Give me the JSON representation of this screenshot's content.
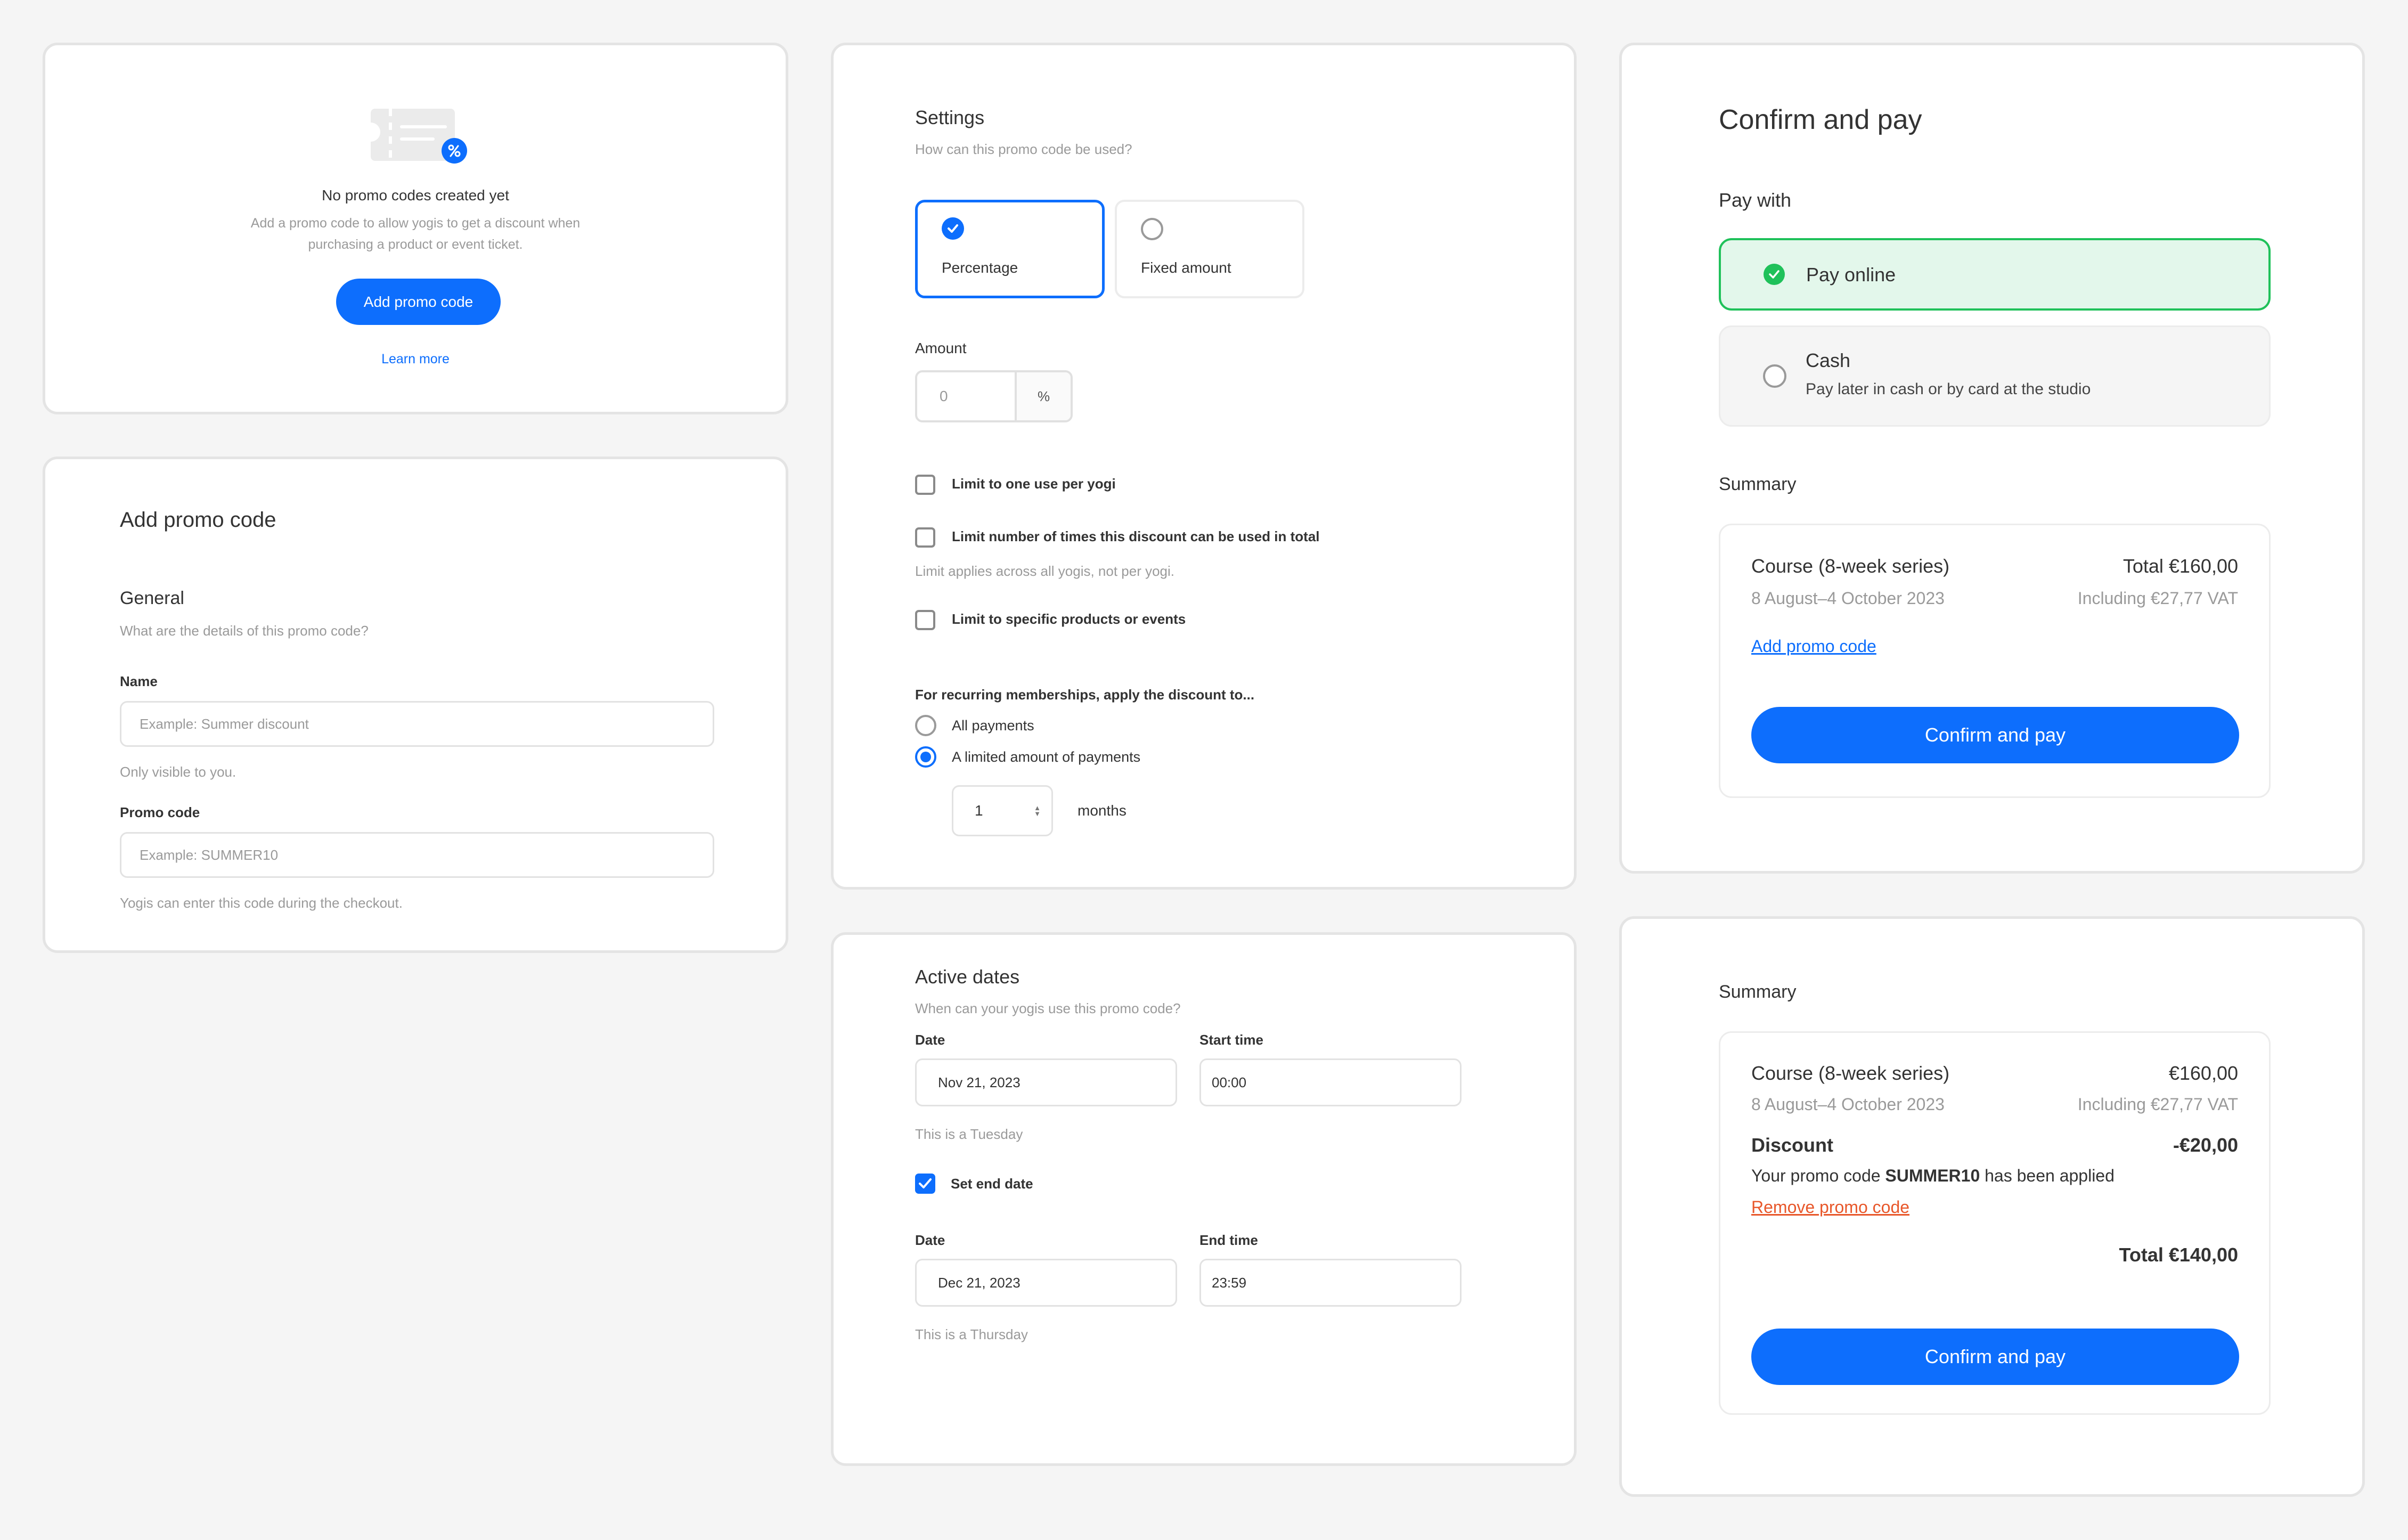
{
  "empty_state": {
    "icon": "ticket-percent-icon",
    "title": "No promo codes created yet",
    "description_line1": "Add a promo code to allow yogis to get a discount when",
    "description_line2": "purchasing a product or event ticket.",
    "add_button": "Add promo code",
    "learn_more": "Learn more"
  },
  "add_form": {
    "title": "Add promo code",
    "section_title": "General",
    "section_subtitle": "What are the details of this promo code?",
    "name_label": "Name",
    "name_placeholder": "Example: Summer discount",
    "name_help": "Only visible to you.",
    "code_label": "Promo code",
    "code_placeholder": "Example: SUMMER10",
    "code_help": "Yogis can enter this code during the checkout."
  },
  "settings": {
    "title": "Settings",
    "subtitle": "How can this promo code be used?",
    "type_options": [
      {
        "label": "Percentage",
        "selected": true
      },
      {
        "label": "Fixed amount",
        "selected": false
      }
    ],
    "amount_label": "Amount",
    "amount_placeholder": "0",
    "amount_unit": "%",
    "limits": [
      {
        "label": "Limit to one use per yogi",
        "checked": false
      },
      {
        "label": "Limit number of times this discount can be used in total",
        "checked": false,
        "help": "Limit applies across all yogis, not per yogi."
      },
      {
        "label": "Limit to specific products or events",
        "checked": false
      }
    ],
    "recurring_label": "For recurring memberships, apply the discount to...",
    "recurring_options": [
      {
        "label": "All payments",
        "selected": false
      },
      {
        "label": "A limited amount of payments",
        "selected": true
      }
    ],
    "months_value": "1",
    "months_unit": "months"
  },
  "active_dates": {
    "title": "Active dates",
    "subtitle": "When can your yogis use this promo code?",
    "start_date_label": "Date",
    "start_date_value": "Nov 21, 2023",
    "start_time_label": "Start time",
    "start_time_value": "00:00",
    "start_day_help": "This is a Tuesday",
    "set_end_date_label": "Set end date",
    "set_end_date_checked": true,
    "end_date_label": "Date",
    "end_date_value": "Dec 21, 2023",
    "end_time_label": "End time",
    "end_time_value": "23:59",
    "end_day_help": "This is a Thursday"
  },
  "checkout": {
    "title": "Confirm and pay",
    "pay_with_label": "Pay with",
    "methods": [
      {
        "title": "Pay online",
        "selected": true
      },
      {
        "title": "Cash",
        "description": "Pay later in cash or by card at the studio",
        "selected": false
      }
    ],
    "summary_label": "Summary",
    "item_name": "Course (8-week series)",
    "item_total": "Total €160,00",
    "item_dates": "8 August–4 October 2023",
    "item_vat": "Including €27,77 VAT",
    "add_promo_link": "Add promo code",
    "confirm_button": "Confirm and pay"
  },
  "summary_applied": {
    "summary_label": "Summary",
    "item_name": "Course (8-week series)",
    "item_price": "€160,00",
    "item_dates": "8 August–4 October 2023",
    "item_vat": "Including €27,77 VAT",
    "discount_label": "Discount",
    "discount_value": "-€20,00",
    "applied_prefix": "Your promo code ",
    "applied_code": "SUMMER10",
    "applied_suffix": " has been applied",
    "remove_link": "Remove promo code",
    "total": "Total €140,00",
    "confirm_button": "Confirm and pay"
  },
  "colors": {
    "accent": "#0d6efd",
    "success": "#1fc15a",
    "success_bg": "#e3f7eb",
    "danger": "#e8572a",
    "background": "#f5f5f5"
  }
}
